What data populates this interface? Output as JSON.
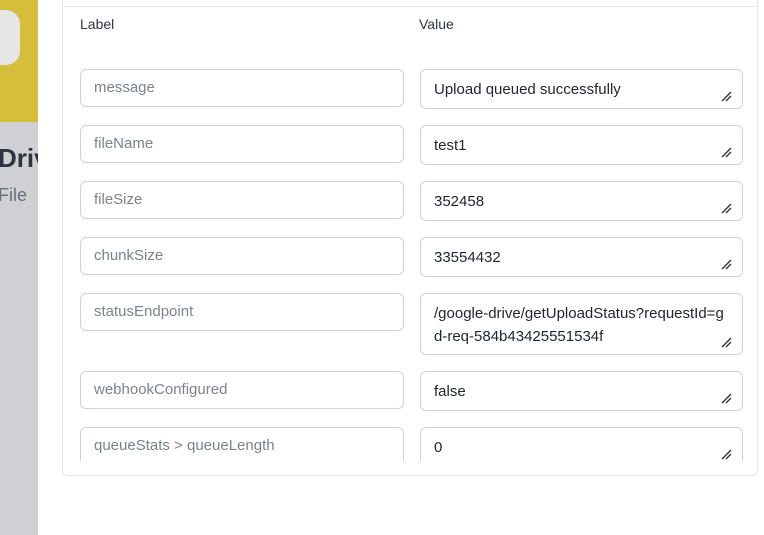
{
  "background_app": {
    "title": "Driv",
    "subtitle": "File"
  },
  "table": {
    "label_header": "Label",
    "value_header": "Value",
    "rows": [
      {
        "label": "message",
        "value": "Upload queued successfully"
      },
      {
        "label": "fileName",
        "value": "test1"
      },
      {
        "label": "fileSize",
        "value": "352458"
      },
      {
        "label": "chunkSize",
        "value": "33554432"
      },
      {
        "label": "statusEndpoint",
        "value": "/google-drive/getUploadStatus?requestId=gd-req-584b43425551534f"
      },
      {
        "label": "webhookConfigured",
        "value": "false"
      },
      {
        "label": "queueStats > queueLength",
        "value": "0"
      }
    ]
  },
  "icons": {
    "resize": "resize-handle-icon"
  },
  "colors": {
    "accent_yellow": "#d6bd3a",
    "border": "#ced3d9"
  }
}
